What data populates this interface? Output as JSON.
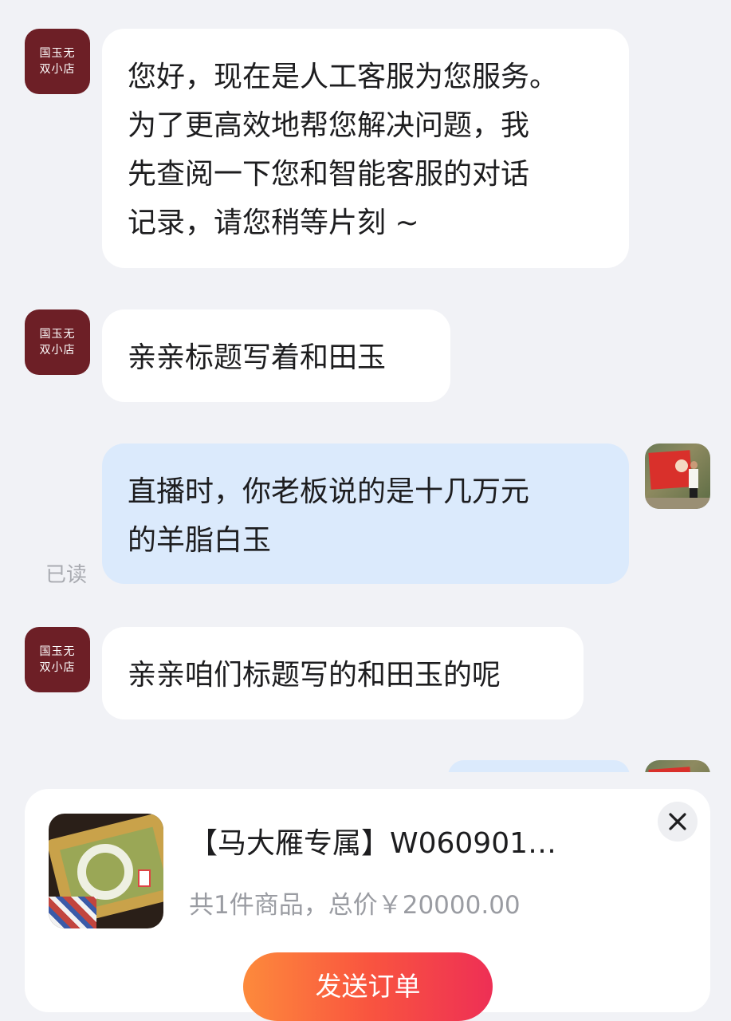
{
  "messages": [
    {
      "from": "shop",
      "avatar_lines": [
        "国玉无",
        "双小店"
      ],
      "text": "您好，现在是人工客服为您服务。\n为了更高效地帮您解决问题，我\n先查阅一下您和智能客服的对话\n记录，请您稍等片刻 ~"
    },
    {
      "from": "shop",
      "avatar_lines": [
        "国玉无",
        "双小店"
      ],
      "text": "亲亲标题写着和田玉"
    },
    {
      "from": "user",
      "text": "直播时，你老板说的是十几万元\n的羊脂白玉",
      "status": "已读"
    },
    {
      "from": "shop",
      "avatar_lines": [
        "国玉无",
        "双小店"
      ],
      "text": "亲亲咱们标题写的和田玉的呢"
    }
  ],
  "order_card": {
    "title": "【马大雁专属】W060901…",
    "summary": "共1件商品，总价￥20000.00",
    "send_button": "发送订单",
    "close_icon": "close-icon",
    "thumbnail": "jade-bangle-thumbnail"
  },
  "colors": {
    "background": "#f1f2f6",
    "incoming_bubble": "#ffffff",
    "outgoing_bubble": "#dbeafc",
    "shop_avatar": "#6d1f26",
    "send_gradient_start": "#fd8a3c",
    "send_gradient_end": "#ee2f55"
  }
}
